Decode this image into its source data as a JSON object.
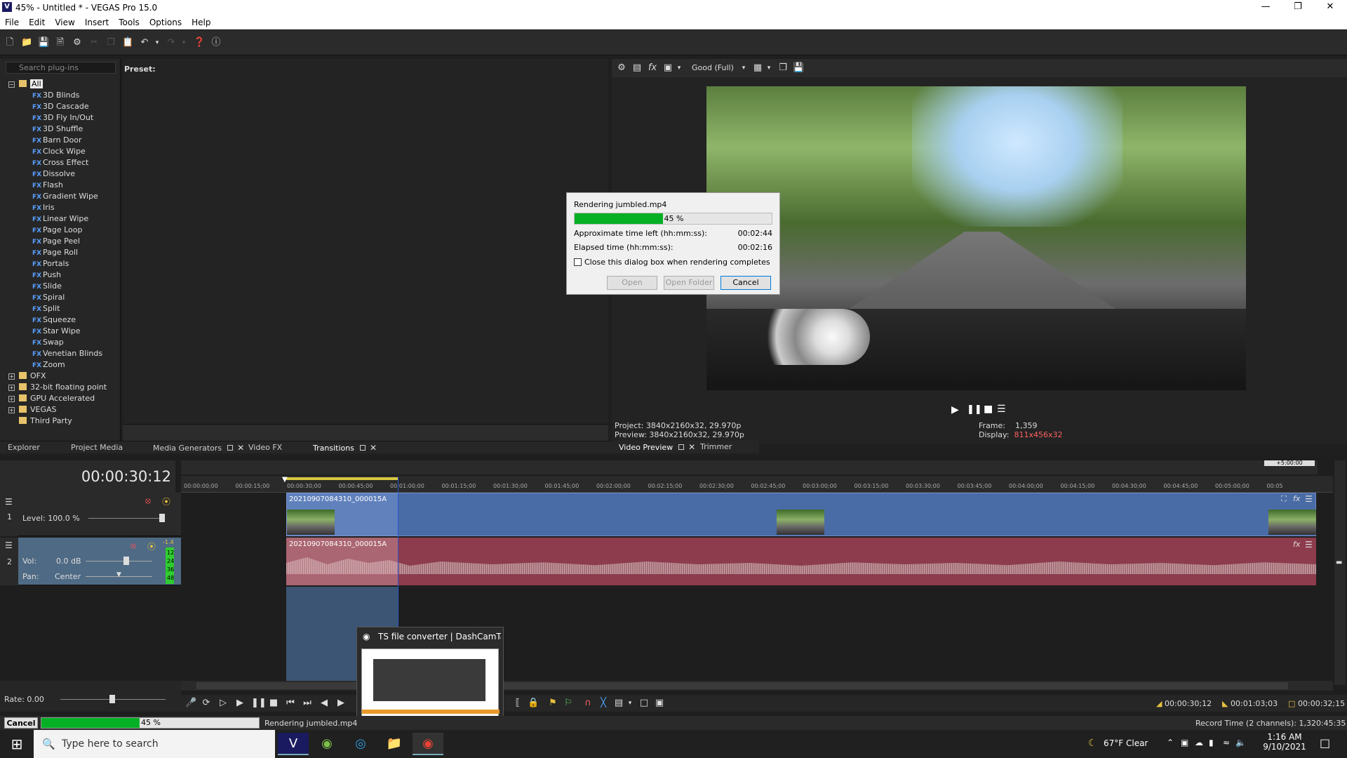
{
  "window": {
    "title": "45% - Untitled * - VEGAS Pro 15.0",
    "app_icon": "V"
  },
  "menu": [
    "File",
    "Edit",
    "View",
    "Insert",
    "Tools",
    "Options",
    "Help"
  ],
  "plugins": {
    "search_placeholder": "Search plug-ins",
    "preset_label": "Preset:",
    "root": "All",
    "items": [
      "3D Blinds",
      "3D Cascade",
      "3D Fly In/Out",
      "3D Shuffle",
      "Barn Door",
      "Clock Wipe",
      "Cross Effect",
      "Dissolve",
      "Flash",
      "Gradient Wipe",
      "Iris",
      "Linear Wipe",
      "Page Loop",
      "Page Peel",
      "Page Roll",
      "Portals",
      "Push",
      "Slide",
      "Spiral",
      "Split",
      "Squeeze",
      "Star Wipe",
      "Swap",
      "Venetian Blinds",
      "Zoom"
    ],
    "groups": [
      "OFX",
      "32-bit floating point",
      "GPU Accelerated",
      "VEGAS",
      "Third Party"
    ],
    "fx_tag": "FX"
  },
  "lefttabs": [
    "Explorer",
    "Project Media",
    "Media Generators",
    "Video FX",
    "Transitions"
  ],
  "preview": {
    "quality": "Good (Full)",
    "project": "Project:  3840x2160x32, 29.970p",
    "preview": "Preview:  3840x2160x32, 29.970p",
    "frame_label": "Frame:",
    "frame": "1,359",
    "display_label": "Display:",
    "display": "811x456x32",
    "display_color": "#ff6060",
    "tabs": [
      "Video Preview",
      "Trimmer"
    ]
  },
  "dialog": {
    "title": "Rendering jumbled.mp4",
    "progress": 45,
    "progress_text": "45 %",
    "time_left_label": "Approximate time left (hh:mm:ss):",
    "time_left": "00:02:44",
    "elapsed_label": "Elapsed time (hh:mm:ss):",
    "elapsed": "00:02:16",
    "close_label": "Close this dialog box when rendering completes",
    "btn_open": "Open",
    "btn_open_folder": "Open Folder",
    "btn_cancel": "Cancel"
  },
  "timeline": {
    "timecode": "00:00:30:12",
    "ruler_marker": "+5:00:00",
    "ticks": [
      "00:00:00;00",
      "00:00:15;00",
      "00:00:30;00",
      "00:00:45;00",
      "00:01:00;00",
      "00:01:15;00",
      "00:01:30;00",
      "00:01:45;00",
      "00:02:00;00",
      "00:02:15;00",
      "00:02:30;00",
      "00:02:45;00",
      "00:03:00;00",
      "00:03:15;00",
      "00:03:30;00",
      "00:03:45;00",
      "00:04:00;00",
      "00:04:15;00",
      "00:04:30;00",
      "00:04:45;00",
      "00:05:00;00",
      "00:05"
    ],
    "track1": {
      "num": "1",
      "level": "Level: 100.0 %",
      "clip": "20210907084310_000015A"
    },
    "track2": {
      "num": "2",
      "vol_label": "Vol:",
      "vol": "0.0 dB",
      "pan_label": "Pan:",
      "pan": "Center",
      "clip": "20210907084310_000015A",
      "meter": [
        "12",
        "24",
        "36",
        "48"
      ],
      "meter_top": "-1.4"
    },
    "rate": "Rate: 0.00",
    "tc_start": "00:00:30;12",
    "tc_end": "00:01:03;03",
    "tc_len": "00:00:32;15"
  },
  "status": {
    "cancel": "Cancel",
    "progress": 45,
    "progress_text": "45 %",
    "rendering": "Rendering jumbled.mp4",
    "record_time": "Record Time (2 channels): 1,320:45:35"
  },
  "taskbar": {
    "search_placeholder": "Type here to search",
    "thumb_title": "TS file converter | DashCamTalk...",
    "weather": "67°F  Clear",
    "time": "1:16 AM",
    "date": "9/10/2021"
  }
}
